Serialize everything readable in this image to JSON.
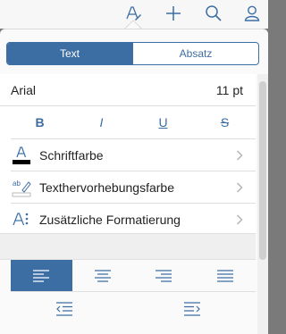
{
  "toolbar": {
    "icons": [
      "text-format-icon",
      "plus-icon",
      "search-icon",
      "user-icon"
    ]
  },
  "tabs": [
    {
      "label": "Text",
      "active": true
    },
    {
      "label": "Absatz",
      "active": false
    }
  ],
  "font": {
    "name": "Arial",
    "size": "11 pt"
  },
  "styles": [
    {
      "label": "B",
      "name": "bold"
    },
    {
      "label": "I",
      "name": "italic"
    },
    {
      "label": "U",
      "name": "underline"
    },
    {
      "label": "S",
      "name": "strikethrough"
    }
  ],
  "rows": [
    {
      "label": "Schriftfarbe",
      "icon": "font-color-icon"
    },
    {
      "label": "Texthervorhebungsfarbe",
      "icon": "highlight-color-icon"
    },
    {
      "label": "Zusätzliche Formatierung",
      "icon": "more-formatting-icon"
    }
  ],
  "alignment": {
    "options": [
      "left",
      "center",
      "right",
      "justify"
    ],
    "selected": "left"
  },
  "indent": [
    "decrease-indent-icon",
    "increase-indent-icon"
  ],
  "colors": {
    "accent": "#3c6ea4",
    "font_color_swatch": "#000000"
  }
}
